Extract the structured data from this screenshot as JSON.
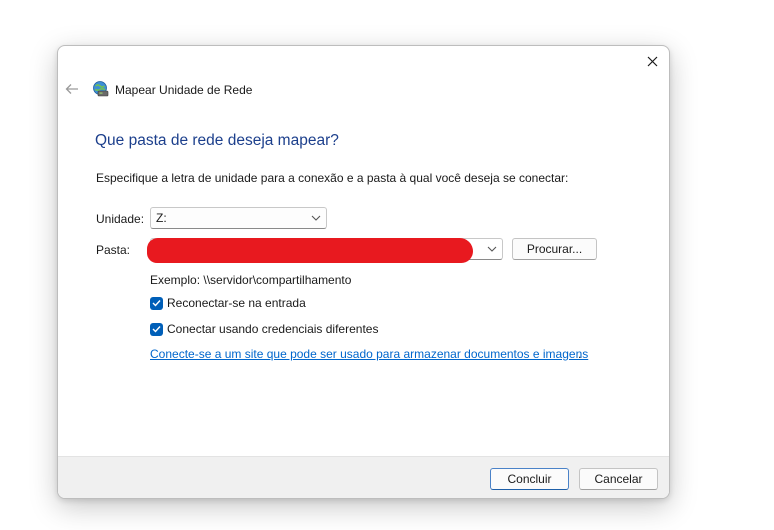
{
  "window": {
    "title": "Mapear Unidade de Rede",
    "close_glyph": "✕",
    "back_glyph": "←"
  },
  "main": {
    "heading": "Que pasta de rede deseja mapear?",
    "instruction": "Especifique a letra de unidade para a conexão e a pasta à qual você deseja se conectar:"
  },
  "form": {
    "drive_label": "Unidade:",
    "drive_value": "Z:",
    "folder_label": "Pasta:",
    "folder_value": "",
    "browse_label": "Procurar...",
    "example": "Exemplo: \\\\servidor\\compartilhamento",
    "reconnect_label": "Reconectar-se na entrada",
    "reconnect_checked": true,
    "credentials_label": "Conectar usando credenciais diferentes",
    "credentials_checked": true,
    "link_text": "Conecte-se a um site que pode ser usado para armazenar documentos e imagens",
    "link_suffix": "."
  },
  "footer": {
    "finish_label": "Concluir",
    "cancel_label": "Cancelar"
  },
  "icons": {
    "close": "close-icon",
    "back": "back-arrow-icon",
    "title": "network-drive-icon",
    "dropdown": "chevron-down-icon",
    "checkbox": "checkmark-icon"
  },
  "colors": {
    "heading": "#1c3f8c",
    "accent": "#005fb8",
    "link": "#0066cc",
    "redaction": "#e8191f",
    "footer_bg": "#f0f0f0"
  }
}
